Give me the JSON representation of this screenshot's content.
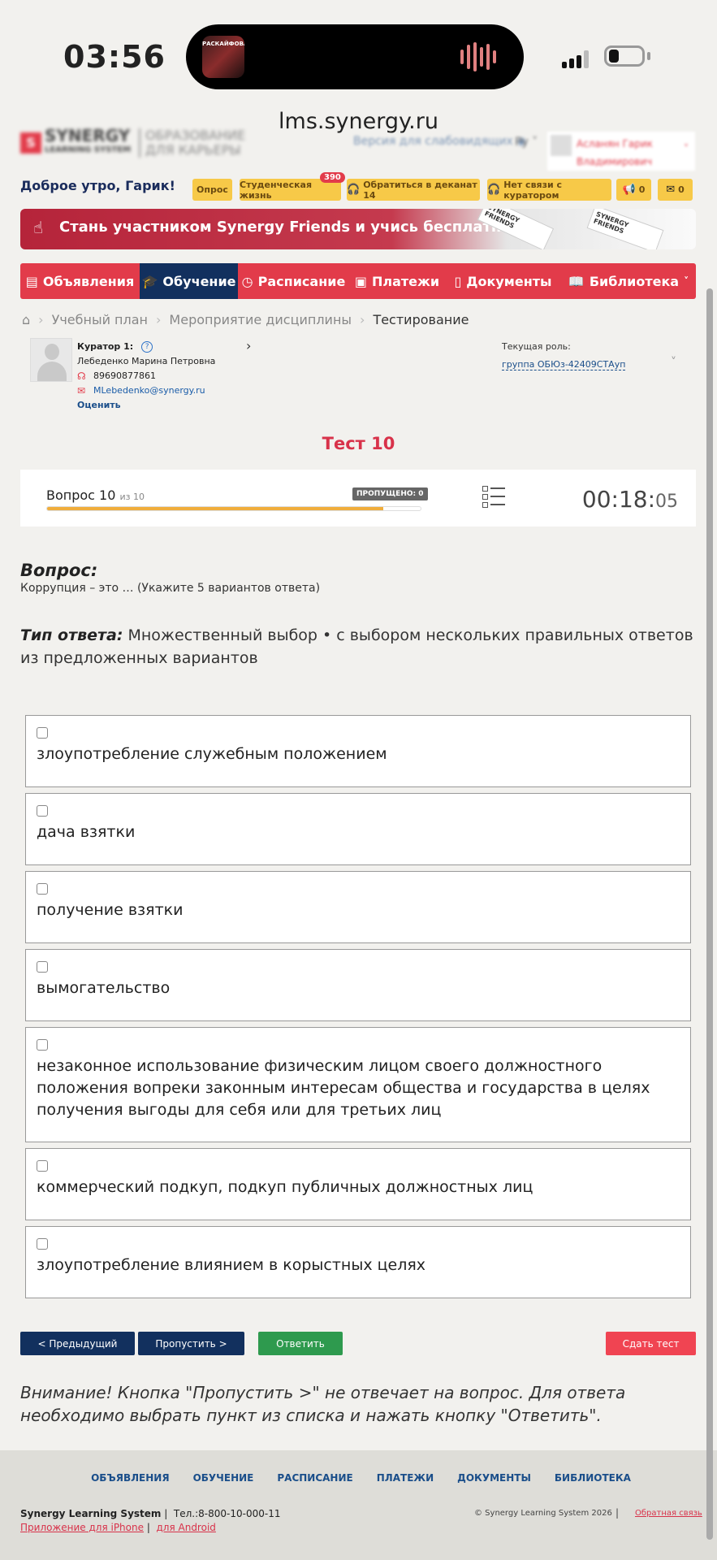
{
  "status_bar": {
    "time": "03:56",
    "island_art_text": "РАСКАЙФОВАНЫ"
  },
  "browser": {
    "url": "lms.synergy.ru"
  },
  "header": {
    "logo_mark": "S",
    "logo_line1": "SYNERGY",
    "logo_line2": "LEARNING SYSTEM",
    "logo_sub1": "ОБРАЗОВАНИЕ",
    "logo_sub2": "ДЛЯ КАРЬЕРЫ",
    "accessibility_label": "Версия для слабовидящих",
    "language": "Ру",
    "user_name_line1": "Асланян Гарик",
    "user_name_line2": "Владимирович"
  },
  "greeting": "Доброе утро, Гарик!",
  "quick_links": {
    "survey": "Опрос",
    "student_life": "Студенческая жизнь",
    "student_life_badge": "390",
    "dean": "Обратиться в деканат 14",
    "curator": "Нет связи с куратором",
    "announcements_count": "0",
    "messages_count": "0"
  },
  "banner": {
    "text": "Стань участником Synergy Friends и учись бесплатно!",
    "deco1": "SYNERGY FRIENDS",
    "deco2": "SYNERGY FRIENDS"
  },
  "nav": {
    "items": [
      {
        "label": "Объявления",
        "icon": "announcement-icon"
      },
      {
        "label": "Обучение",
        "icon": "graduation-cap-icon"
      },
      {
        "label": "Расписание",
        "icon": "clock-icon"
      },
      {
        "label": "Платежи",
        "icon": "wallet-icon"
      },
      {
        "label": "Документы",
        "icon": "document-icon"
      },
      {
        "label": "Библиотека",
        "icon": "book-icon"
      }
    ],
    "active_index": 1
  },
  "breadcrumb": {
    "items": [
      "Учебный план",
      "Мероприятие дисциплины",
      "Тестирование"
    ]
  },
  "curator": {
    "title": "Куратор 1:",
    "help": "?",
    "name": "Лебеденко Марина Петровна",
    "phone": "89690877861",
    "email": "MLebedenko@synergy.ru",
    "rate_label": "Оценить"
  },
  "role": {
    "label": "Текущая роль:",
    "value": "группа ОБЮз-42409СТАуп"
  },
  "test": {
    "title": "Тест 10",
    "question_label": "Вопрос 10",
    "question_of": "из 10",
    "skipped_label": "ПРОПУЩЕНО: 0",
    "progress_fraction": 0.9,
    "timer_main": "00:18:",
    "timer_seconds": "05"
  },
  "question": {
    "heading": "Вопрос:",
    "text": "Коррупция – это … (Укажите 5 вариантов ответа)",
    "answer_type_label": "Тип ответа:",
    "answer_type_value": "Множественный выбор • с выбором нескольких правильных ответов из предложенных вариантов"
  },
  "options": [
    "злоупотребление служебным положением",
    "дача взятки",
    "получение взятки",
    "вымогательство",
    "незаконное использование физическим лицом своего должностного положения вопреки законным интересам общества и государства в целях получения выгоды для себя или для третьих лиц",
    "коммерческий подкуп, подкуп публичных должностных лиц",
    "злоупотребление влиянием в корыстных целях"
  ],
  "buttons": {
    "prev": "< Предыдущий",
    "skip": "Пропустить >",
    "answer": "Ответить",
    "finish": "Сдать тест"
  },
  "warning": "Внимание! Кнопка \"Пропустить >\" не отвечает на вопрос. Для ответа необходимо выбрать пункт из списка и нажать кнопку \"Ответить\".",
  "footer": {
    "links": [
      "ОБЪЯВЛЕНИЯ",
      "ОБУЧЕНИЕ",
      "РАСПИСАНИЕ",
      "ПЛАТЕЖИ",
      "ДОКУМЕНТЫ",
      "БИБЛИОТЕКА"
    ],
    "company": "Synergy Learning System",
    "phone": "Тел.:8-800-10-000-11",
    "app_iphone": "Приложение для iPhone",
    "app_android": "для Android",
    "copyright": "© Synergy Learning System 2026",
    "feedback": "Обратная связь"
  },
  "colors": {
    "brand_red": "#e23b4a",
    "navy": "#12305e",
    "green": "#2e9a4e",
    "yellow": "#f7c948",
    "progress": "#f0ad3c"
  }
}
